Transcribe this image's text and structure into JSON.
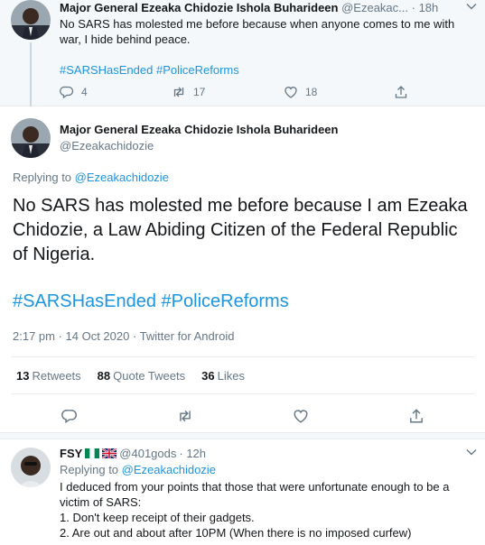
{
  "tweet1": {
    "author_name": "Major General Ezeaka Chidozie Ishola Buharideen",
    "handle": "@Ezeakac...",
    "time": "· 18h",
    "text": "No SARS has molested me before because when anyone comes to me with war, I hide behind peace.",
    "hashtag1": "#SARSHasEnded",
    "hashtag2": "#PoliceReforms",
    "reply_count": "4",
    "retweet_count": "17",
    "like_count": "18"
  },
  "tweet2": {
    "author_name": "Major General Ezeaka Chidozie Ishola Buharideen",
    "handle": "@Ezeakachidozie",
    "replying_prefix": "Replying to",
    "replying_handle": "@Ezeakachidozie",
    "text": "No SARS has molested me before because I am Ezeaka Chidozie, a Law Abiding Citizen of the Federal Republic of Nigeria.",
    "hashtag1": "#SARSHasEnded",
    "hashtag2": "#PoliceReforms",
    "meta": "2:17 pm · 14 Oct 2020 · Twitter for Android",
    "retweets_count": "13",
    "retweets_label": "Retweets",
    "quotes_count": "88",
    "quotes_label": "Quote Tweets",
    "likes_count": "36",
    "likes_label": "Likes"
  },
  "tweet3": {
    "author_name": "FSY",
    "handle": "@401gods",
    "time": "· 12h",
    "replying_prefix": "Replying to",
    "replying_handle": "@Ezeakachidozie",
    "line1": "I deduced from your points that those that were unfortunate enough to be a victim of SARS:",
    "line2": "1. Don't keep receipt of their gadgets.",
    "line3": "2. Are out and about after 10PM (When there is no imposed curfew)"
  },
  "icons": [
    "chevron-down-icon",
    "reply-icon",
    "retweet-icon",
    "like-icon",
    "share-icon",
    "nigeria-flag-icon",
    "uk-flag-icon"
  ],
  "colors": {
    "link": "#1b95e0",
    "muted": "#657786",
    "text": "#14171a",
    "thread_bg": "#f5f8fa",
    "border": "#e6ecf0"
  }
}
